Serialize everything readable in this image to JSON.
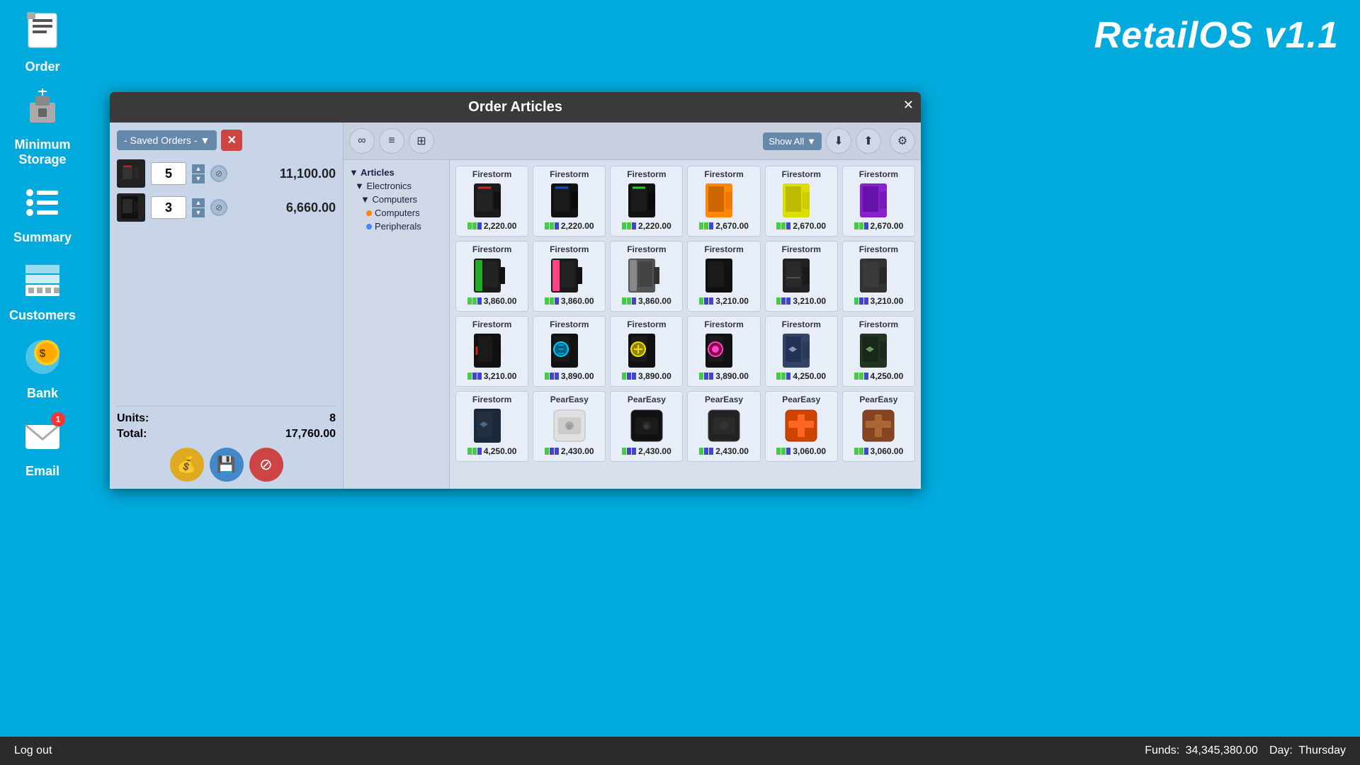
{
  "app": {
    "title": "RetailOS v1.1"
  },
  "sidebar": {
    "items": [
      {
        "id": "order",
        "label": "Order",
        "icon": "📋"
      },
      {
        "id": "minimum-storage",
        "label": "Minimum\nStorage",
        "icon": "🏭"
      },
      {
        "id": "summary",
        "label": "Summary",
        "icon": "📊"
      },
      {
        "id": "customers",
        "label": "Customers",
        "icon": "🛒"
      },
      {
        "id": "bank",
        "label": "Bank",
        "icon": "💰"
      },
      {
        "id": "email",
        "label": "Email",
        "icon": "✉",
        "badge": 1
      }
    ]
  },
  "modal": {
    "title": "Order Articles",
    "saved_orders_label": "- Saved Orders -",
    "order_items": [
      {
        "qty": 5,
        "price": "11,100.00"
      },
      {
        "qty": 3,
        "price": "6,660.00"
      }
    ],
    "units_label": "Units:",
    "units_value": "8",
    "total_label": "Total:",
    "total_value": "17,760.00"
  },
  "right_panel": {
    "show_all_label": "Show All",
    "tree": [
      {
        "label": "▼ Articles",
        "level": 0
      },
      {
        "label": "▼ Electronics",
        "level": 1
      },
      {
        "label": "▼ Computers",
        "level": 2
      },
      {
        "label": "● Computers",
        "level": 3,
        "dot": "orange"
      },
      {
        "label": "● Peripherals",
        "level": 3,
        "dot": "blue"
      }
    ],
    "products": [
      {
        "name": "Firestorm",
        "price": "2,220.00",
        "color": "#cc2222",
        "style": "red-stripe"
      },
      {
        "name": "Firestorm",
        "price": "2,220.00",
        "color": "#2244cc",
        "style": "blue-stripe"
      },
      {
        "name": "Firestorm",
        "price": "2,220.00",
        "color": "#22cc22",
        "style": "green-stripe"
      },
      {
        "name": "Firestorm",
        "price": "2,670.00",
        "color": "#ff8800",
        "style": "orange"
      },
      {
        "name": "Firestorm",
        "price": "2,670.00",
        "color": "#dddd00",
        "style": "yellow"
      },
      {
        "name": "Firestorm",
        "price": "2,670.00",
        "color": "#8822cc",
        "style": "purple"
      },
      {
        "name": "Firestorm",
        "price": "3,860.00",
        "color": "#22cc44",
        "style": "green-panel"
      },
      {
        "name": "Firestorm",
        "price": "3,860.00",
        "color": "#ff4488",
        "style": "pink-panel"
      },
      {
        "name": "Firestorm",
        "price": "3,860.00",
        "color": "#aaaaaa",
        "style": "grey-panel"
      },
      {
        "name": "Firestorm",
        "price": "3,210.00",
        "color": "#222222",
        "style": "black"
      },
      {
        "name": "Firestorm",
        "price": "3,210.00",
        "color": "#333333",
        "style": "black2"
      },
      {
        "name": "Firestorm",
        "price": "3,210.00",
        "color": "#444444",
        "style": "dark"
      },
      {
        "name": "Firestorm",
        "price": "3,210.00",
        "color": "#111111",
        "style": "black-red"
      },
      {
        "name": "Firestorm",
        "price": "3,890.00",
        "color": "#00ccff",
        "style": "cyan"
      },
      {
        "name": "Firestorm",
        "price": "3,890.00",
        "color": "#ffdd00",
        "style": "yellow2"
      },
      {
        "name": "Firestorm",
        "price": "3,890.00",
        "color": "#ff44cc",
        "style": "pink2"
      },
      {
        "name": "Firestorm",
        "price": "4,250.00",
        "color": "#334466",
        "style": "darkblue"
      },
      {
        "name": "Firestorm",
        "price": "4,250.00",
        "color": "#223322",
        "style": "darkgreen"
      },
      {
        "name": "Firestorm",
        "price": "4,250.00",
        "color": "#224455",
        "style": "navy"
      },
      {
        "name": "PearEasy",
        "price": "2,430.00",
        "color": "#cccccc",
        "style": "white-box"
      },
      {
        "name": "PearEasy",
        "price": "2,430.00",
        "color": "#111111",
        "style": "black-box"
      },
      {
        "name": "PearEasy",
        "price": "2,430.00",
        "color": "#222222",
        "style": "dark-box"
      },
      {
        "name": "PearEasy",
        "price": "3,060.00",
        "color": "#cc4400",
        "style": "orange-cross"
      },
      {
        "name": "PearEasy",
        "price": "3,060.00",
        "color": "#884422",
        "style": "brown-cross"
      }
    ]
  },
  "statusbar": {
    "logout_label": "Log out",
    "funds_label": "Funds:",
    "funds_value": "34,345,380.00",
    "day_label": "Day:",
    "day_value": "Thursday"
  }
}
